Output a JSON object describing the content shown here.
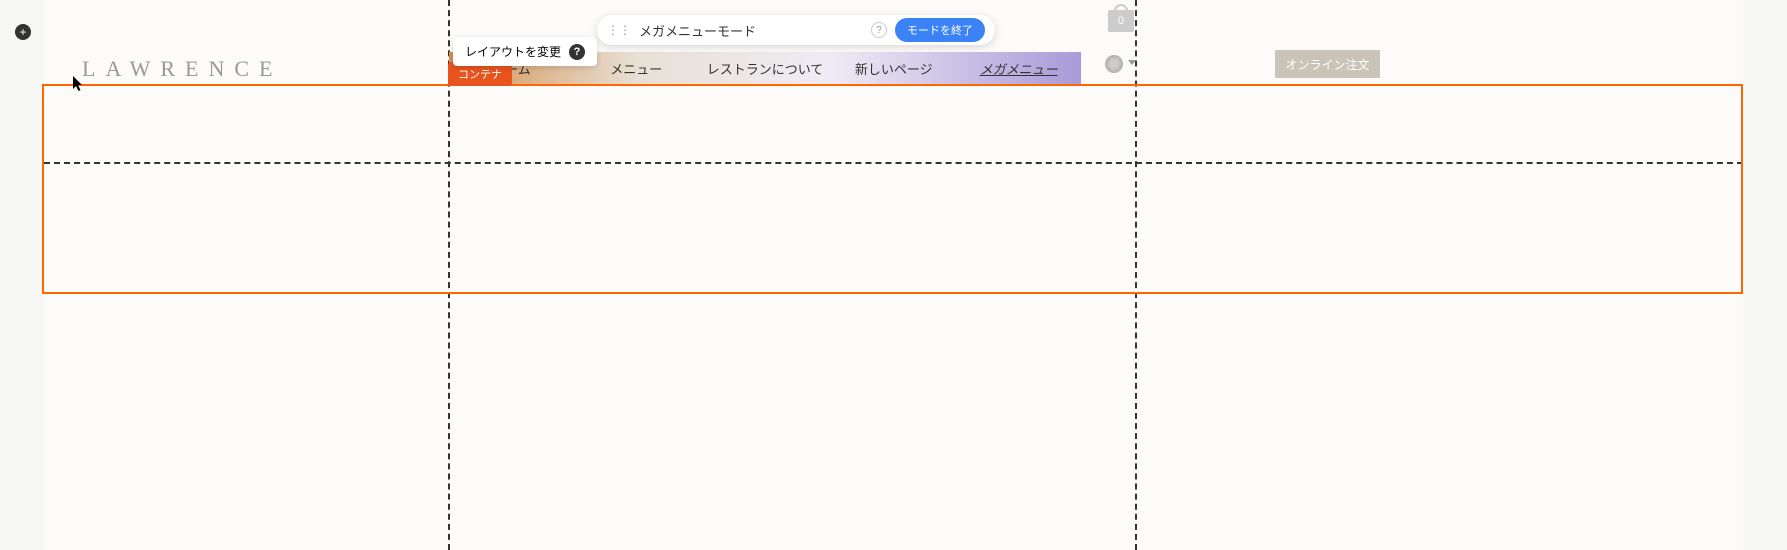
{
  "logo": "LAWRENCE",
  "mode_banner": {
    "text": "メガメニューモード",
    "end_button": "モードを終了"
  },
  "layout_tooltip": "レイアウトを変更",
  "container_badge": "コンテナ",
  "nav": {
    "items": [
      {
        "label": "ホーム"
      },
      {
        "label": "メニュー"
      },
      {
        "label": "レストランについて"
      },
      {
        "label": "新しいページ"
      },
      {
        "label": "メガメニュー"
      }
    ]
  },
  "cart": {
    "count": "0"
  },
  "order_button": "オンライン注文"
}
